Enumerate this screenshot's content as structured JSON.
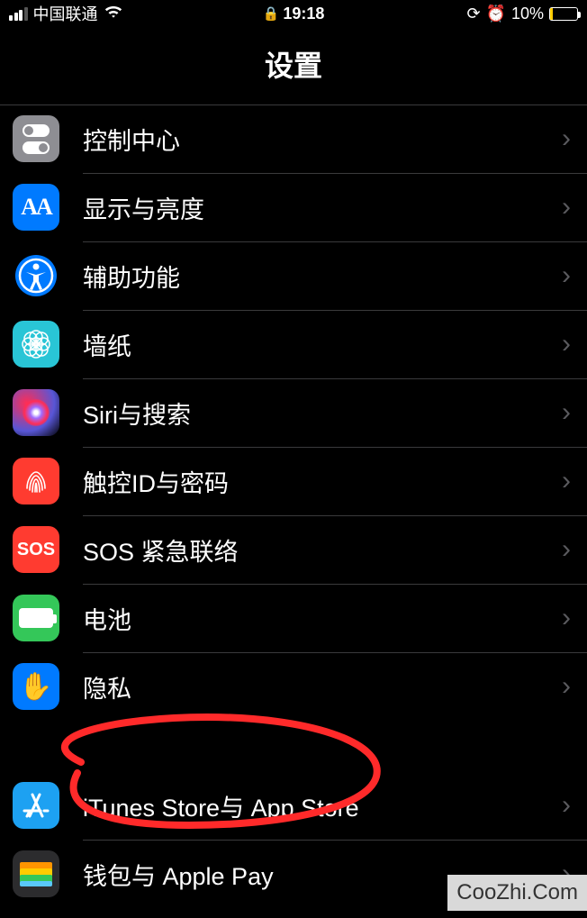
{
  "status": {
    "carrier": "中国联通",
    "time": "19:18",
    "battery_pct": "10%",
    "battery_fill_pct": 10
  },
  "header": {
    "title": "设置"
  },
  "rows": {
    "control": {
      "label": "控制中心"
    },
    "display": {
      "label": "显示与亮度"
    },
    "access": {
      "label": "辅助功能"
    },
    "wallpaper": {
      "label": "墙纸"
    },
    "siri": {
      "label": "Siri与搜索"
    },
    "touchid": {
      "label": "触控ID与密码"
    },
    "sos": {
      "label": "SOS 紧急联络",
      "icon_text": "SOS"
    },
    "battery": {
      "label": "电池"
    },
    "privacy": {
      "label": "隐私"
    },
    "itunes": {
      "label": "iTunes Store与 App Store"
    },
    "wallet": {
      "label": "钱包与 Apple Pay"
    }
  },
  "watermark": "CooZhi.Com"
}
